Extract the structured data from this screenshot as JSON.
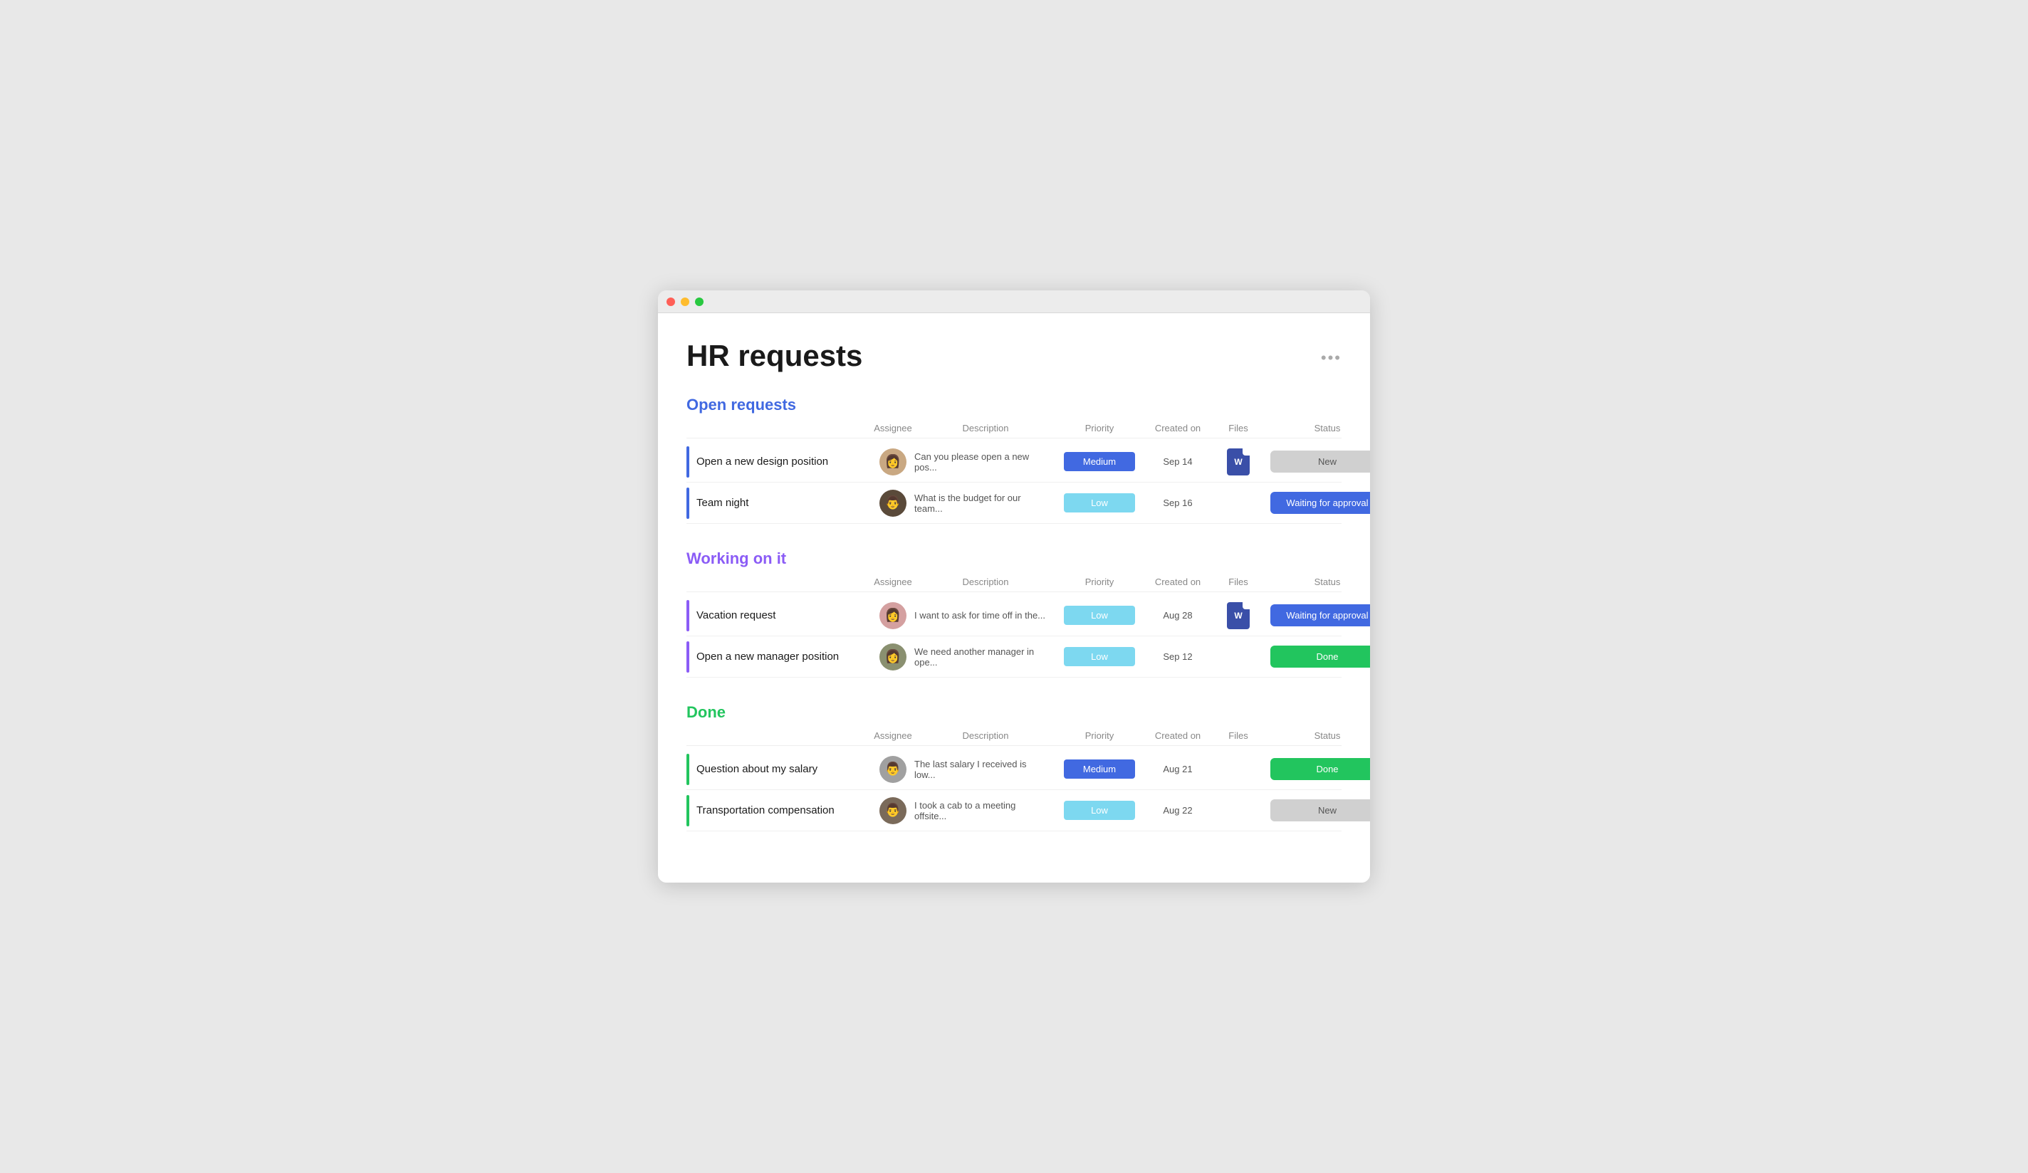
{
  "app": {
    "title": "HR requests",
    "more_icon": "•••"
  },
  "sections": [
    {
      "id": "open",
      "title": "Open requests",
      "color_class": "blue",
      "border_class": "lb-blue",
      "columns": {
        "assignee": "Assignee",
        "description": "Description",
        "priority": "Priority",
        "created_on": "Created on",
        "files": "Files",
        "status": "Status"
      },
      "rows": [
        {
          "name": "Open a new design position",
          "description": "Can you please open a new pos...",
          "priority": "Medium",
          "priority_class": "priority-medium",
          "date": "Sep 14",
          "has_file": true,
          "status": "New",
          "status_class": "status-new",
          "avatar_class": "avatar-1",
          "avatar_emoji": "👩"
        },
        {
          "name": "Team night",
          "description": "What is the budget for our team...",
          "priority": "Low",
          "priority_class": "priority-low",
          "date": "Sep 16",
          "has_file": false,
          "status": "Waiting for approval",
          "status_class": "status-waiting",
          "avatar_class": "avatar-2",
          "avatar_emoji": "👨"
        }
      ]
    },
    {
      "id": "working",
      "title": "Working on it",
      "color_class": "purple",
      "border_class": "lb-purple",
      "columns": {
        "assignee": "Assignee",
        "description": "Description",
        "priority": "Priority",
        "created_on": "Created on",
        "files": "Files",
        "status": "Status"
      },
      "rows": [
        {
          "name": "Vacation request",
          "description": "I want to ask for time off in the...",
          "priority": "Low",
          "priority_class": "priority-low",
          "date": "Aug 28",
          "has_file": true,
          "status": "Waiting for approval",
          "status_class": "status-waiting",
          "avatar_class": "avatar-3",
          "avatar_emoji": "👩"
        },
        {
          "name": "Open a new manager position",
          "description": "We need another manager in ope...",
          "priority": "Low",
          "priority_class": "priority-low",
          "date": "Sep 12",
          "has_file": false,
          "status": "Done",
          "status_class": "status-done",
          "avatar_class": "avatar-4",
          "avatar_emoji": "👩"
        }
      ]
    },
    {
      "id": "done",
      "title": "Done",
      "color_class": "green",
      "border_class": "lb-green",
      "columns": {
        "assignee": "Assignee",
        "description": "Description",
        "priority": "Priority",
        "created_on": "Created on",
        "files": "Files",
        "status": "Status"
      },
      "rows": [
        {
          "name": "Question about my salary",
          "description": "The last salary I received is low...",
          "priority": "Medium",
          "priority_class": "priority-medium",
          "date": "Aug 21",
          "has_file": false,
          "status": "Done",
          "status_class": "status-done",
          "avatar_class": "avatar-5",
          "avatar_emoji": "👨"
        },
        {
          "name": "Transportation compensation",
          "description": "I took a cab to a meeting offsite...",
          "priority": "Low",
          "priority_class": "priority-low",
          "date": "Aug 22",
          "has_file": false,
          "status": "New",
          "status_class": "status-new",
          "avatar_class": "avatar-6",
          "avatar_emoji": "👨"
        }
      ]
    }
  ]
}
